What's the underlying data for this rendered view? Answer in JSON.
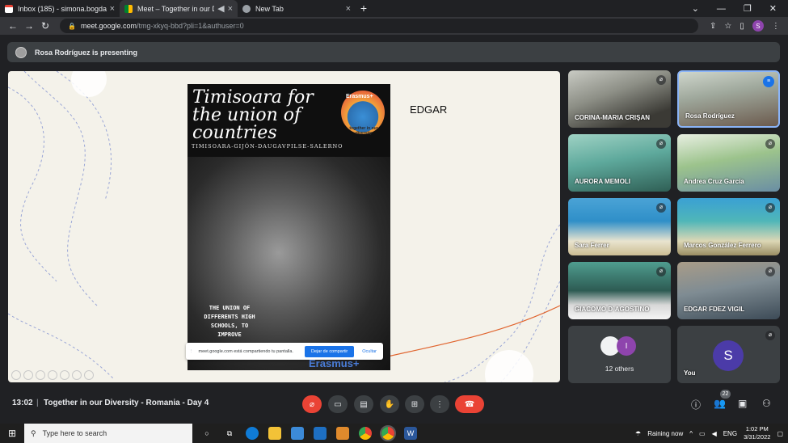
{
  "browser": {
    "tabs": [
      {
        "title": "Inbox (185) - simona.bogdanesc",
        "icon": "gmail-icon",
        "active": false
      },
      {
        "title": "Meet – Together in our Diver",
        "icon": "meet-icon",
        "active": true
      },
      {
        "title": "New Tab",
        "icon": "chrome-icon",
        "active": false
      }
    ],
    "new_tab": "+",
    "address": {
      "host": "meet.google.com",
      "path": "/tmg-xkyq-bbd?pli=1&authuser=0"
    },
    "profile_initial": "S"
  },
  "presenting": {
    "text": "Rosa Rodríguez is presenting"
  },
  "shared_screen": {
    "poster_title": "Timisoara for the union of countries",
    "poster_subtitle": "TIMISOARA-GIJÓN-DAUGAVPILSE-SALERNO",
    "logo_text": "Erasmus+",
    "logo_caption": "together in our diversity",
    "poster_body": "THE UNION OF DIFFERENTS HIGH SCHOOLS, TO IMPROVE",
    "poster_bottom": "Erasmus+",
    "side_label": "EDGAR",
    "share_toast": {
      "message": "meet.google.com está compartiendo tu pantalla.",
      "stop_button": "Dejar de compartir",
      "hide_button": "Ocultar"
    }
  },
  "participants": [
    {
      "name": "CORINA-MARIA CRIŞAN",
      "muted": true
    },
    {
      "name": "Rosa Rodríguez",
      "muted": false,
      "speaking": true
    },
    {
      "name": "AURORA MEMOLI",
      "muted": true
    },
    {
      "name": "Andrea Cruz García",
      "muted": true
    },
    {
      "name": "Sara Ferrer",
      "muted": true
    },
    {
      "name": "Marcos González Ferrero",
      "muted": true
    },
    {
      "name": "GIACOMO D`AGOSTINO",
      "muted": true
    },
    {
      "name": "EDGAR FDEZ VIGIL",
      "muted": true
    }
  ],
  "others": {
    "label": "12 others",
    "avatar_initial": "I"
  },
  "you": {
    "label": "You",
    "initial": "S"
  },
  "meeting": {
    "time": "13:02",
    "separator": "|",
    "title": "Together in our Diversity - Romania - Day 4",
    "people_count": "22"
  },
  "taskbar": {
    "search_placeholder": "Type here to search",
    "weather": "Raining now",
    "language": "ENG",
    "time": "1:02 PM",
    "date": "3/31/2022"
  }
}
